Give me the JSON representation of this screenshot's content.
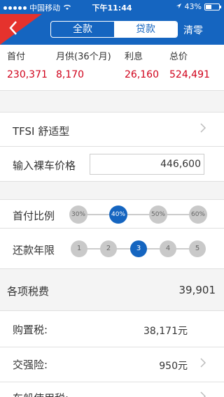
{
  "status_bar": {
    "carrier": "中国移动",
    "time": "下午11:44",
    "battery": "43%",
    "battery_level": 0.43,
    "icons": [
      "signal-dots-icon",
      "wifi-icon",
      "location-arrow-icon",
      "battery-icon"
    ]
  },
  "nav": {
    "back_icon": "chevron-left-icon",
    "tabs": [
      {
        "label": "全款",
        "active": false
      },
      {
        "label": "贷款",
        "active": true
      }
    ],
    "clear_label": "清零"
  },
  "summary": [
    {
      "label": "首付",
      "value": "230,371"
    },
    {
      "label": "月供(36个月)",
      "value": "8,170"
    },
    {
      "label": "利息",
      "value": "26,160"
    },
    {
      "label": "总价",
      "value": "524,491"
    }
  ],
  "model": {
    "label": "TFSI 舒适型",
    "chevron_icon": "chevron-right-icon"
  },
  "price": {
    "label": "输入裸车价格",
    "value": "446,600"
  },
  "down_payment": {
    "label": "首付比例",
    "options": [
      "30%",
      "40%",
      "50%",
      "60%"
    ],
    "selected": "40%"
  },
  "loan_term": {
    "label": "还款年限",
    "options": [
      "1",
      "2",
      "3",
      "4",
      "5"
    ],
    "selected": "3"
  },
  "fees": {
    "label": "各项税费",
    "total": "39,901"
  },
  "taxes": [
    {
      "label": "购置税:",
      "amount": "38,171元",
      "has_chevron": false
    },
    {
      "label": "交强险:",
      "amount": "950元",
      "has_chevron": true
    },
    {
      "label": "车船使用税:",
      "amount": "",
      "has_chevron": true
    }
  ],
  "colors": {
    "nav_blue": "#1565c0",
    "accent_red": "#e5322d",
    "value_red": "#d0021b"
  }
}
